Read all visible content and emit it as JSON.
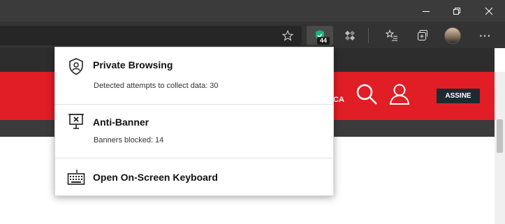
{
  "window": {
    "controls": {
      "minimize": "minimize-icon",
      "restore": "restore-icon",
      "close": "close-icon"
    }
  },
  "toolbar": {
    "favorite_icon": "star-icon",
    "extension_badge": "44",
    "more_label": "···"
  },
  "popup": {
    "items": [
      {
        "title": "Private Browsing",
        "subtitle": "Detected attempts to collect data: 30",
        "icon": "shield-user-icon"
      },
      {
        "title": "Anti-Banner",
        "subtitle": "Banners blocked: 14",
        "icon": "blocked-billboard-icon"
      },
      {
        "title": "Open On-Screen Keyboard",
        "icon": "keyboard-icon"
      }
    ]
  },
  "page": {
    "partial_text": "CA",
    "subscribe_label": "ASSINE",
    "colors": {
      "brand_red": "#e11d25",
      "subscribe_bg": "#1e2a32",
      "extension_green": "#1db27a"
    }
  }
}
